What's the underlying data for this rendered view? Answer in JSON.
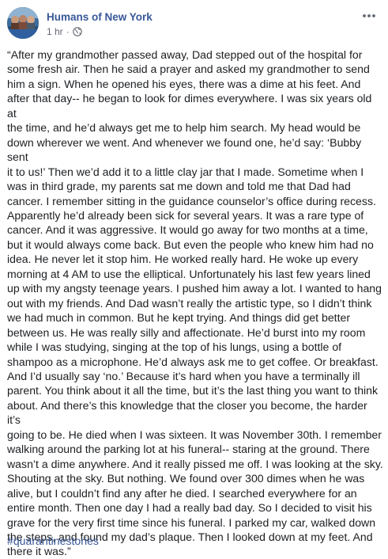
{
  "post": {
    "page_name": "Humans of New York",
    "timestamp": "1 hr",
    "separator": "·",
    "avatar_icon": "avatar-photo",
    "audience_icon": "globe-icon",
    "options_icon": "more-options-icon",
    "link_color": "#385898",
    "meta_color": "#616770",
    "text_color": "#1c1e21",
    "body": "“After my grandmother passed away, Dad stepped out of the hospital for\nsome fresh air. Then he said a prayer and asked my grandmother to send\nhim a sign. When he opened his eyes, there was a dime at his feet. And\nafter that day-- he began to look for dimes everywhere. I was six years old at\nthe time, and he’d always get me to help him search. My head would be\ndown wherever we went. And whenever we found one, he’d say: ‘Bubby sent\nit to us!’ Then we’d add it to a little clay jar that I made. Sometime when I\nwas in third grade, my parents sat me down and told me that Dad had\ncancer. I remember sitting in the guidance counselor’s office during recess.\nApparently he’d already been sick for several years. It was a rare type of\ncancer. And it was aggressive. It would go away for two months at a time,\nbut it would always come back. But even the people who knew him had no\nidea. He never let it stop him. He worked really hard. He woke up every\nmorning at 4 AM to use the elliptical. Unfortunately his last few years lined\nup with my angsty teenage years. I pushed him away a lot. I wanted to hang\nout with my friends. And Dad wasn’t really the artistic type, so I didn’t think\nwe had much in common. But he kept trying. And things did get better\nbetween us. He was really silly and affectionate. He’d burst into my room\nwhile I was studying, singing at the top of his lungs, using a bottle of\nshampoo as a microphone. He’d always ask me to get coffee. Or breakfast.\nAnd I’d usually say ‘no.’ Because it’s hard when you have a terminally ill\nparent. You think about it all the time, but it’s the last thing you want to think\nabout. And there’s this knowledge that the closer you become, the harder it’s\ngoing to be. He died when I was sixteen. It was November 30th. I remember\nwalking around the parking lot at his funeral-- staring at the ground. There\nwasn’t a dime anywhere. And it really pissed me off. I was looking at the sky.\nShouting at the sky. But nothing. We found over 300 dimes when he was\nalive, but I couldn’t find any after he died. I searched everywhere for an\nentire month. Then one day I had a really bad day. So I decided to visit his\ngrave for the very first time since his funeral. I parked my car, walked down\nthe steps, and found my dad’s plaque. Then I looked down at my feet. And\nthere it was.”",
    "hashtag": "#quarantinestories"
  }
}
